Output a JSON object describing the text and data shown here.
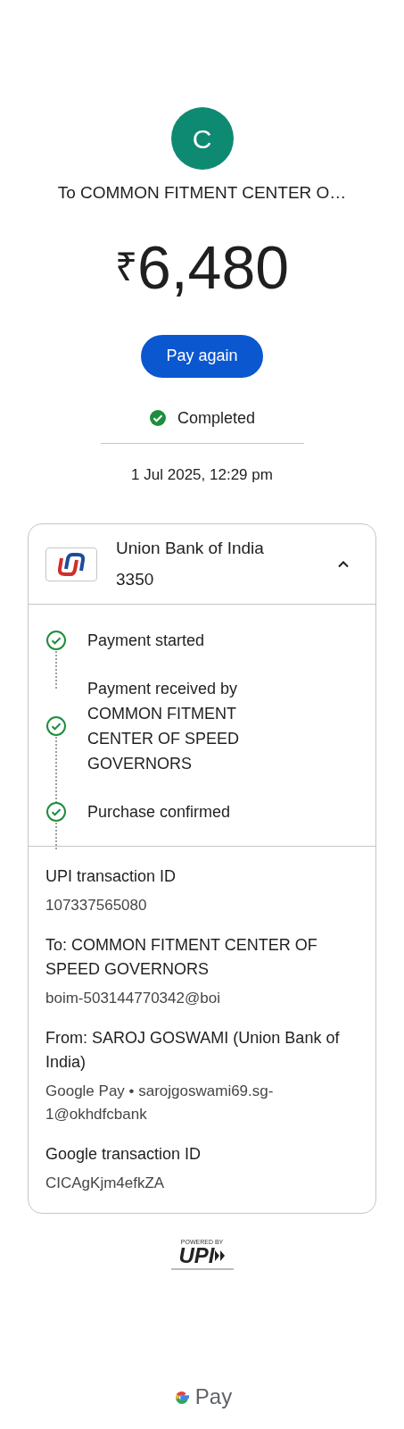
{
  "payee": {
    "initial": "C",
    "title": "To COMMON FITMENT CENTER O…"
  },
  "amount": {
    "currency": "₹",
    "value": "6,480"
  },
  "pay_again_button": "Pay again",
  "status": {
    "label": "Completed",
    "completed": true
  },
  "datetime": "1 Jul 2025, 12:29 pm",
  "account": {
    "bank": "Union Bank of India",
    "number": "3350",
    "expanded": true
  },
  "steps": [
    {
      "label": "Payment started",
      "done": true
    },
    {
      "label": "Payment received by COMMON FITMENT CENTER OF SPEED GOVERNORS",
      "done": true
    },
    {
      "label": "Purchase confirmed",
      "done": true
    }
  ],
  "details": [
    {
      "label": "UPI transaction ID",
      "value": "107337565080"
    },
    {
      "label": "To: COMMON FITMENT CENTER OF SPEED GOVERNORS",
      "value": "boim-503144770342@boi"
    },
    {
      "label": "From: SAROJ GOSWAMI (Union Bank of India)",
      "value": "Google Pay • sarojgoswami69.sg-1@okhdfcbank"
    },
    {
      "label": "Google transaction ID",
      "value": "CICAgKjm4efkZA"
    }
  ],
  "upi_badge": {
    "powered_by": "POWERED BY",
    "brand": "UPI"
  },
  "footer_brand": {
    "name": "Pay"
  }
}
